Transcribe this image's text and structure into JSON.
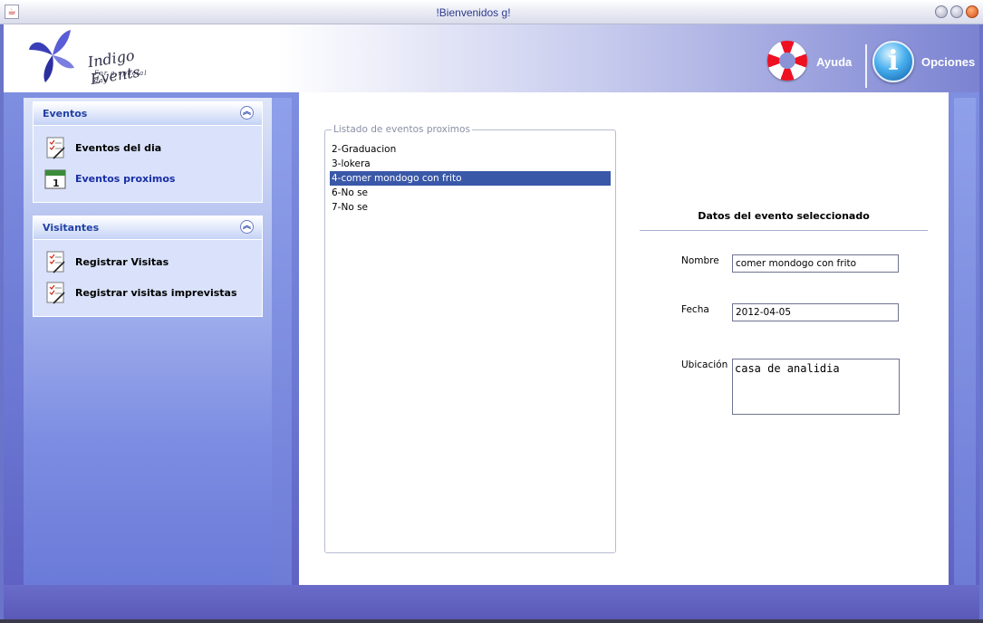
{
  "window": {
    "title": "!Bienvenidos g!"
  },
  "header": {
    "logo_text": "Indigo Events",
    "logo_tagline": "For a special day",
    "help_label": "Ayuda",
    "options_label": "Opciones",
    "options_icon_glyph": "i"
  },
  "sidebar": {
    "eventos_panel": {
      "title": "Eventos",
      "items": [
        {
          "label": "Eventos del dia",
          "icon": "checklist-icon"
        },
        {
          "label": "Eventos proximos",
          "icon": "calendar-icon"
        }
      ]
    },
    "visitantes_panel": {
      "title": "Visitantes",
      "items": [
        {
          "label": "Registrar Visitas",
          "icon": "checklist-icon"
        },
        {
          "label": "Registrar visitas imprevistas",
          "icon": "checklist-icon"
        }
      ]
    },
    "collapse_glyph": "︽"
  },
  "events_list": {
    "legend": "Listado de eventos proximos",
    "items": [
      "2-Graduacion",
      "3-lokera",
      "4-comer mondogo con frito",
      "6-No se",
      "7-No se"
    ],
    "selected_index": 2
  },
  "details": {
    "title": "Datos del evento seleccionado",
    "nombre_label": "Nombre",
    "nombre_value": "comer mondogo con frito",
    "fecha_label": "Fecha",
    "fecha_value": "2012-04-05",
    "ubicacion_label": "Ubicación",
    "ubicacion_value": "casa de analidia"
  },
  "colors": {
    "accent": "#3a58a8",
    "panel_title": "#2141a6",
    "body_bg": "#6a76d2"
  }
}
